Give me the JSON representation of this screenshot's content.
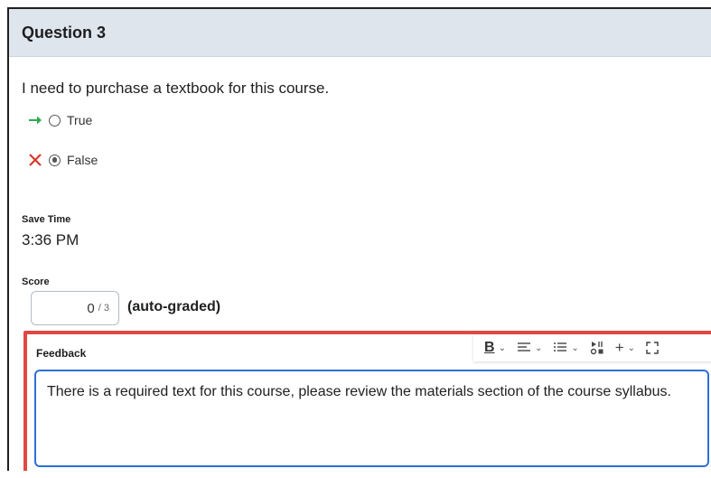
{
  "question": {
    "title": "Question 3",
    "prompt": "I need to purchase a textbook for this course.",
    "options": [
      {
        "label": "True",
        "indicator": "correct-arrow",
        "selected": false,
        "indicator_color": "#2bab4f"
      },
      {
        "label": "False",
        "indicator": "incorrect-x",
        "selected": true,
        "indicator_color": "#d9382e"
      }
    ]
  },
  "save_time": {
    "label": "Save Time",
    "value": "3:36 PM"
  },
  "score": {
    "label": "Score",
    "value": "0",
    "denominator": "/ 3",
    "note": "(auto-graded)"
  },
  "feedback": {
    "label": "Feedback",
    "text": "There is a required text for this course, please review the materials section of the course syllabus.",
    "highlight_color": "#e04843",
    "focus_color": "#2f6fd6"
  },
  "toolbar": {
    "bold_label": "B",
    "items": [
      "bold",
      "align",
      "list",
      "media",
      "insert",
      "fullscreen"
    ]
  }
}
